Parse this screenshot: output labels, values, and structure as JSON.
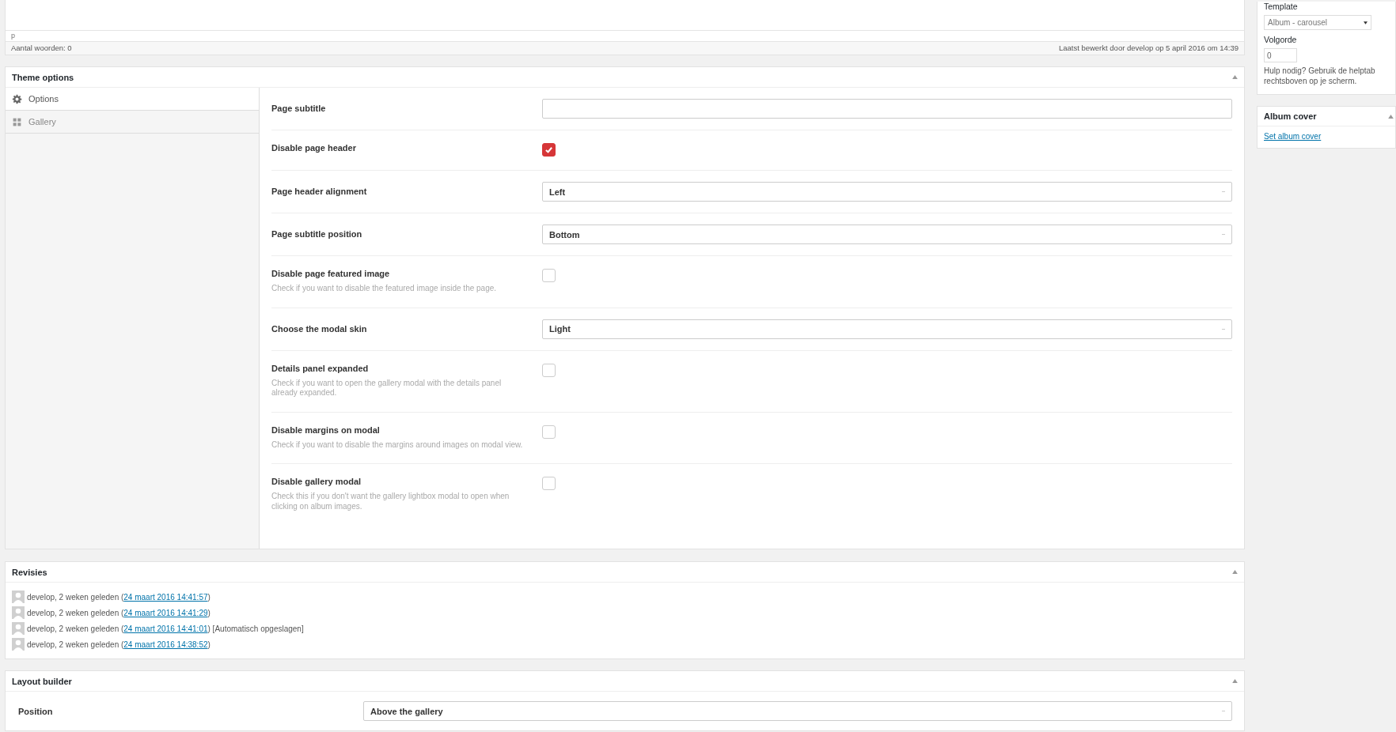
{
  "editor": {
    "path": "p",
    "word_count": "Aantal woorden: 0",
    "last_edited": "Laatst bewerkt door develop op 5 april 2016 om 14:39"
  },
  "theme_options": {
    "title": "Theme options",
    "tabs": [
      {
        "label": "Options",
        "selected": true
      },
      {
        "label": "Gallery",
        "selected": false
      }
    ],
    "fields": [
      {
        "kind": "text",
        "label": "Page subtitle"
      },
      {
        "kind": "checkbox",
        "label": "Disable page header",
        "checked": true
      },
      {
        "kind": "select",
        "label": "Page header alignment",
        "value": "Left"
      },
      {
        "kind": "select",
        "label": "Page subtitle position",
        "value": "Bottom"
      },
      {
        "kind": "checkbox",
        "label": "Disable page featured image",
        "description": "Check if you want to disable the featured image inside the page.",
        "checked": false
      },
      {
        "kind": "select",
        "label": "Choose the modal skin",
        "value": "Light"
      },
      {
        "kind": "checkbox",
        "label": "Details panel expanded",
        "description": "Check if you want to open the gallery modal with the details panel already expanded.",
        "checked": false
      },
      {
        "kind": "checkbox",
        "label": "Disable margins on modal",
        "description": "Check if you want to disable the margins around images on modal view.",
        "checked": false
      },
      {
        "kind": "checkbox",
        "label": "Disable gallery modal",
        "description": "Check this if you don't want the gallery lightbox modal to open when clicking on album images.",
        "checked": false
      }
    ]
  },
  "revisions": {
    "title": "Revisies",
    "items": [
      {
        "text": "develop, 2 weken geleden (",
        "link": "24 maart 2016 14:41:57",
        "suffix": ")"
      },
      {
        "text": "develop, 2 weken geleden (",
        "link": "24 maart 2016 14:41:29",
        "suffix": ")"
      },
      {
        "text": "develop, 2 weken geleden (",
        "link": "24 maart 2016 14:41:01",
        "suffix": ") [Automatisch opgeslagen]"
      },
      {
        "text": "develop, 2 weken geleden (",
        "link": "24 maart 2016 14:38:52",
        "suffix": ")"
      }
    ]
  },
  "layout_builder": {
    "title": "Layout builder",
    "fields": [
      {
        "label": "Position",
        "value": "Above the gallery"
      }
    ]
  },
  "sidebar": {
    "template_label": "Template",
    "template_value": "Album - carousel",
    "order_label": "Volgorde",
    "order_value": "0",
    "help": "Hulp nodig? Gebruik de helptab rechtsboven op je scherm.",
    "album_cover": {
      "title": "Album cover",
      "link": "Set album cover"
    }
  }
}
